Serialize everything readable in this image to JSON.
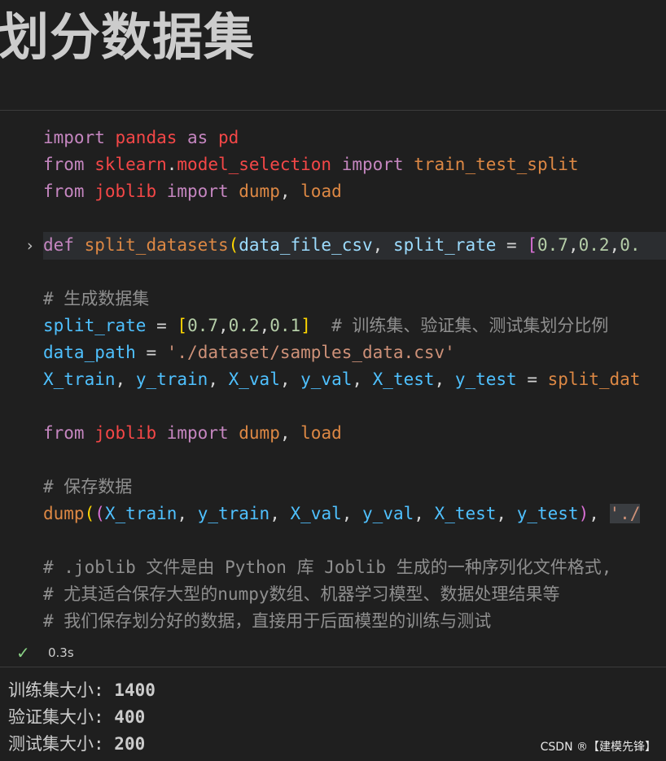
{
  "heading": "划分数据集",
  "code": {
    "l1": {
      "kw": "import",
      "mod": "pandas",
      "as": "as",
      "alias": "pd"
    },
    "l2": {
      "kw": "from",
      "m1": "sklearn",
      "dot": ".",
      "m2": "model_selection",
      "imp": "import",
      "fn": "train_test_split"
    },
    "l3": {
      "kw": "from",
      "mod": "joblib",
      "imp": "import",
      "fn1": "dump",
      "comma": ",",
      "fn2": "load"
    },
    "l4": {
      "kw": "def",
      "fn": "split_datasets",
      "p1": "data_file_csv",
      "p2": "split_rate",
      "eq": "=",
      "n1": "0.7",
      "n2": "0.2",
      "n3": "0."
    },
    "l5": {
      "cmt": "# 生成数据集"
    },
    "l6": {
      "var": "split_rate",
      "eq": "=",
      "n1": "0.7",
      "n2": "0.2",
      "n3": "0.1",
      "cmt": "# 训练集、验证集、测试集划分比例"
    },
    "l7": {
      "var": "data_path",
      "eq": "=",
      "str": "'./dataset/samples_data.csv'"
    },
    "l8": {
      "v1": "X_train",
      "v2": "y_train",
      "v3": "X_val",
      "v4": "y_val",
      "v5": "X_test",
      "v6": "y_test",
      "eq": "=",
      "fn": "split_dat"
    },
    "l9": {
      "kw": "from",
      "mod": "joblib",
      "imp": "import",
      "fn1": "dump",
      "comma": ",",
      "fn2": "load"
    },
    "l10": {
      "cmt": "# 保存数据"
    },
    "l11": {
      "fn": "dump",
      "v1": "X_train",
      "v2": "y_train",
      "v3": "X_val",
      "v4": "y_val",
      "v5": "X_test",
      "v6": "y_test",
      "str": "'./"
    },
    "l12": {
      "cmt": "# .joblib 文件是由 Python 库 Joblib 生成的一种序列化文件格式,"
    },
    "l13": {
      "cmt": "# 尤其适合保存大型的numpy数组、机器学习模型、数据处理结果等"
    },
    "l14": {
      "cmt": "# 我们保存划分好的数据，直接用于后面模型的训练与测试"
    }
  },
  "status": {
    "time": "0.3s"
  },
  "output": [
    {
      "label": "训练集大小: ",
      "value": "1400"
    },
    {
      "label": "验证集大小: ",
      "value": "400"
    },
    {
      "label": "测试集大小: ",
      "value": "200"
    }
  ],
  "watermark": "CSDN ®【建模先锋】",
  "icons": {
    "check": "check-icon",
    "fold": "chevron-right-icon"
  },
  "colors": {
    "background": "#1f1f1f",
    "keyword": "#c586c0",
    "module": "#f44747",
    "function": "#dd8844",
    "variable": "#4fc1ff",
    "number": "#b5cea8",
    "string": "#ce9178",
    "comment": "#8f8f8f",
    "success": "#89d185"
  }
}
